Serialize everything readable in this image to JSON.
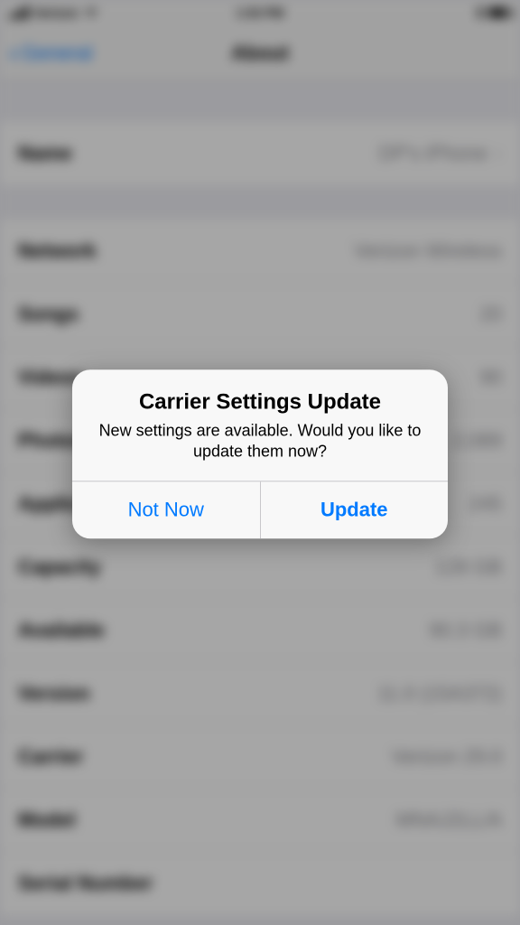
{
  "status": {
    "carrier": "Verizon",
    "time": "1:53 PM",
    "wifi_icon": "wifi-icon",
    "bluetooth_icon": "bluetooth-icon",
    "battery_icon": "battery-icon"
  },
  "nav": {
    "back_label": "General",
    "title": "About"
  },
  "rows_group1": [
    {
      "label": "Name",
      "value": "DP's iPhone",
      "chevron": true
    }
  ],
  "rows_group2": [
    {
      "label": "Network",
      "value": "Verizon Wireless"
    },
    {
      "label": "Songs",
      "value": "20"
    },
    {
      "label": "Videos",
      "value": "90"
    },
    {
      "label": "Photos",
      "value": "2,089"
    },
    {
      "label": "Applications",
      "value": "245"
    },
    {
      "label": "Capacity",
      "value": "128 GB"
    },
    {
      "label": "Available",
      "value": "90.3 GB"
    },
    {
      "label": "Version",
      "value": "11.0 (15A372)"
    },
    {
      "label": "Carrier",
      "value": "Verizon 29.0"
    },
    {
      "label": "Model",
      "value": "MNAJ2LL/A"
    },
    {
      "label": "Serial Number",
      "value": ""
    }
  ],
  "alert": {
    "title": "Carrier Settings Update",
    "message": "New settings are available. Would you like to update them now?",
    "cancel_label": "Not Now",
    "confirm_label": "Update"
  }
}
